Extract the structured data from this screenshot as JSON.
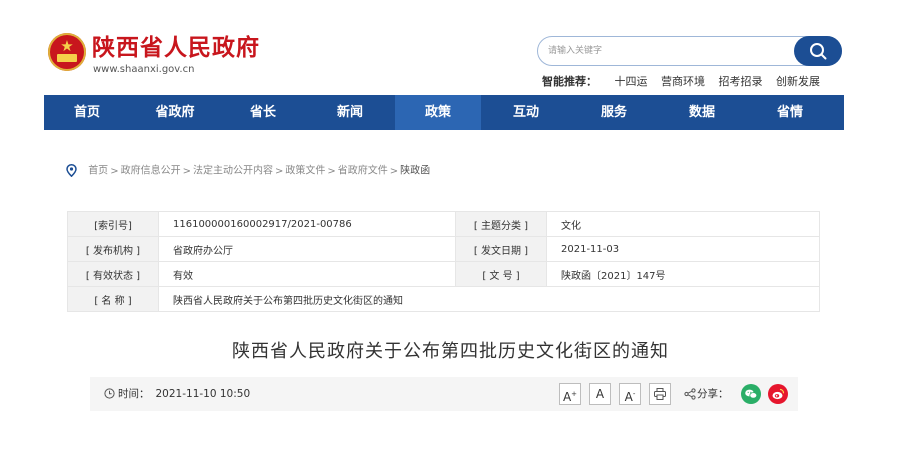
{
  "header": {
    "title": "陕西省人民政府",
    "url": "www.shaanxi.gov.cn",
    "search_placeholder": "请输入关键字",
    "hot_label": "智能推荐：",
    "hot_items": [
      "十四运",
      "营商环境",
      "招考招录",
      "创新发展"
    ]
  },
  "nav": [
    "首页",
    "省政府",
    "省长",
    "新闻",
    "政策",
    "互动",
    "服务",
    "数据",
    "省情"
  ],
  "nav_active": "政策",
  "breadcrumb": [
    "首页",
    "政府信息公开",
    "法定主动公开内容",
    "政策文件",
    "省政府文件",
    "陕政函"
  ],
  "breadcrumb_sep": ">",
  "info": {
    "index_label": "[索引号]",
    "index_value": "11610000016000291​7/2021-00786",
    "topic_label": "[ 主题分类 ]",
    "topic_value": "文化",
    "org_label": "[ 发布机构 ]",
    "org_value": "省政府办公厅",
    "date_label": "[ 发文日期 ]",
    "date_value": "2021-11-03",
    "status_label": "[ 有效状态 ]",
    "status_value": "有效",
    "doc_label": "[ 文 号 ]",
    "doc_value": "陕政函〔2021〕147号",
    "name_label": "[ 名 称 ]",
    "name_value": "陕西省人民政府关于公布第四批历史文化街区的通知"
  },
  "article": {
    "title": "陕西省人民政府关于公布第四批历史文化街区的通知",
    "time_label": "时间：",
    "time_value": "2021-11-10 10:50",
    "font_large": "A",
    "font_large_sup": "+",
    "font_normal": "A",
    "font_small": "A",
    "font_small_sup": "-",
    "share_label": "分享："
  },
  "colors": {
    "brand_red": "#c8161d",
    "nav_blue": "#1c4e94",
    "nav_active": "#2c66b3"
  },
  "icons": [
    "emblem-icon",
    "search-icon",
    "location-pin-icon",
    "clock-icon",
    "print-icon",
    "share-icon",
    "wechat-icon",
    "weibo-icon"
  ]
}
